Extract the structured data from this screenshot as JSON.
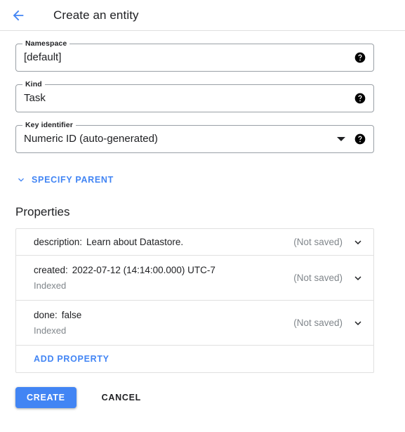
{
  "header": {
    "back_icon": "arrow-back-icon",
    "title": "Create an entity"
  },
  "colors": {
    "accent_blue": "#4285f4",
    "border_gray": "#9aa0a6",
    "card_border": "#e0e0e0",
    "muted_text": "#80868b",
    "text": "#202124"
  },
  "form": {
    "fields": [
      {
        "label": "Namespace",
        "value": "[default]",
        "help_icon": "help-icon",
        "has_dropdown": false
      },
      {
        "label": "Kind",
        "value": "Task",
        "help_icon": "help-icon",
        "has_dropdown": false
      },
      {
        "label": "Key identifier",
        "value": "Numeric ID (auto-generated)",
        "help_icon": "help-icon",
        "has_dropdown": true
      }
    ],
    "specify_parent": {
      "label": "SPECIFY PARENT",
      "icon": "chevron-down-icon"
    }
  },
  "properties": {
    "title": "Properties",
    "rows": [
      {
        "key": "description:",
        "value": "Learn about Datastore.",
        "indexed": "",
        "status": "(Not saved)",
        "expand_icon": "chevron-down-icon"
      },
      {
        "key": "created:",
        "value": "2022-07-12 (14:14:00.000) UTC-7",
        "indexed": "Indexed",
        "status": "(Not saved)",
        "expand_icon": "chevron-down-icon"
      },
      {
        "key": "done:",
        "value": "false",
        "indexed": "Indexed",
        "status": "(Not saved)",
        "expand_icon": "chevron-down-icon"
      }
    ],
    "add_property_label": "ADD PROPERTY"
  },
  "actions": {
    "create_label": "CREATE",
    "cancel_label": "CANCEL"
  }
}
